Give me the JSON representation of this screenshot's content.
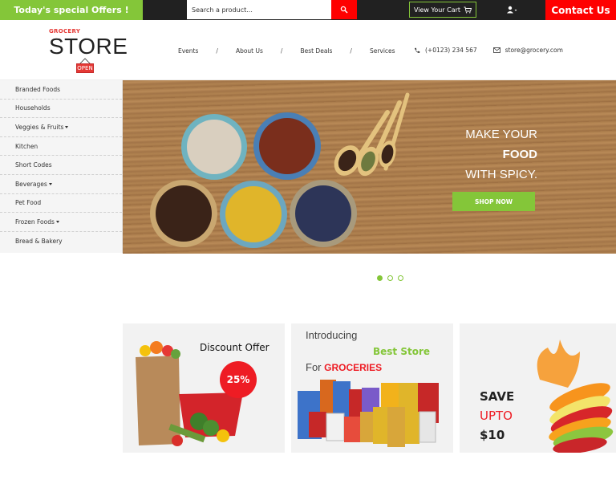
{
  "topbar": {
    "offers_label": "Today's special Offers !",
    "search_placeholder": "Search a product...",
    "search_icon": "search-icon",
    "cart_label": "View Your Cart",
    "cart_icon": "cart-icon",
    "user_icon": "user-icon",
    "contact_label": "Contact Us"
  },
  "header": {
    "logo": {
      "small": "GROCERY",
      "big": "STORE",
      "sign": "OPEN"
    },
    "nav": [
      "Events",
      "About Us",
      "Best Deals",
      "Services"
    ],
    "nav_separator": "/",
    "phone": "(+0123) 234 567",
    "email": "store@grocery.com"
  },
  "sidebar": {
    "items": [
      {
        "label": "Branded Foods",
        "dropdown": false
      },
      {
        "label": "Households",
        "dropdown": false
      },
      {
        "label": "Veggies & Fruits",
        "dropdown": true
      },
      {
        "label": "Kitchen",
        "dropdown": false
      },
      {
        "label": "Short Codes",
        "dropdown": false
      },
      {
        "label": "Beverages",
        "dropdown": true
      },
      {
        "label": "Pet Food",
        "dropdown": false
      },
      {
        "label": "Frozen Foods",
        "dropdown": true
      },
      {
        "label": "Bread & Bakery",
        "dropdown": false
      }
    ]
  },
  "hero": {
    "line1": "MAKE YOUR",
    "line2": "FOOD",
    "line3": "WITH SPICY.",
    "cta": "SHOP NOW",
    "slides_total": 3,
    "active_slide": 1
  },
  "promos": [
    {
      "title": "Discount Offer",
      "badge": "25%"
    },
    {
      "line1": "Introducing",
      "line2": "Best Store",
      "line3_prefix": "For",
      "line3_highlight": "GROCERIES"
    },
    {
      "line1": "SAVE",
      "line2": "UPTO",
      "line3": "$10"
    }
  ],
  "colors": {
    "green": "#84c639",
    "red": "#fe0000",
    "dark": "#212121"
  }
}
